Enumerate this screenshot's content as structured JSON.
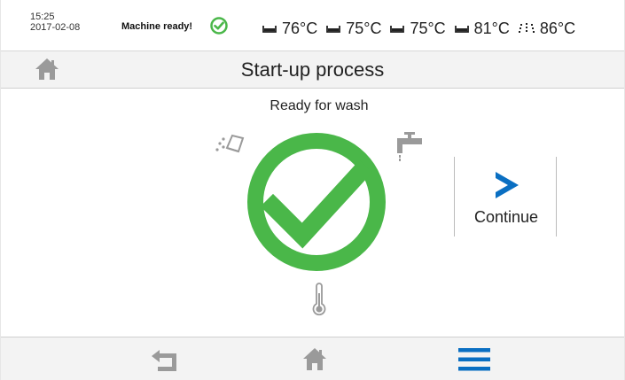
{
  "status": {
    "time": "15:25",
    "date": "2017-02-08",
    "machine_status": "Machine ready!",
    "temps": [
      {
        "icon": "tank-icon",
        "value": "76°C"
      },
      {
        "icon": "tank-icon",
        "value": "75°C"
      },
      {
        "icon": "tank-icon",
        "value": "75°C"
      },
      {
        "icon": "tank-icon",
        "value": "81°C"
      },
      {
        "icon": "rinse-spray-icon",
        "value": "86°C"
      }
    ]
  },
  "header": {
    "title": "Start-up process"
  },
  "main": {
    "status_text": "Ready for wash",
    "continue_label": "Continue"
  },
  "colors": {
    "success_green": "#4ab749",
    "accent_blue": "#0a6fc2",
    "icon_gray": "#9a9a9a"
  }
}
